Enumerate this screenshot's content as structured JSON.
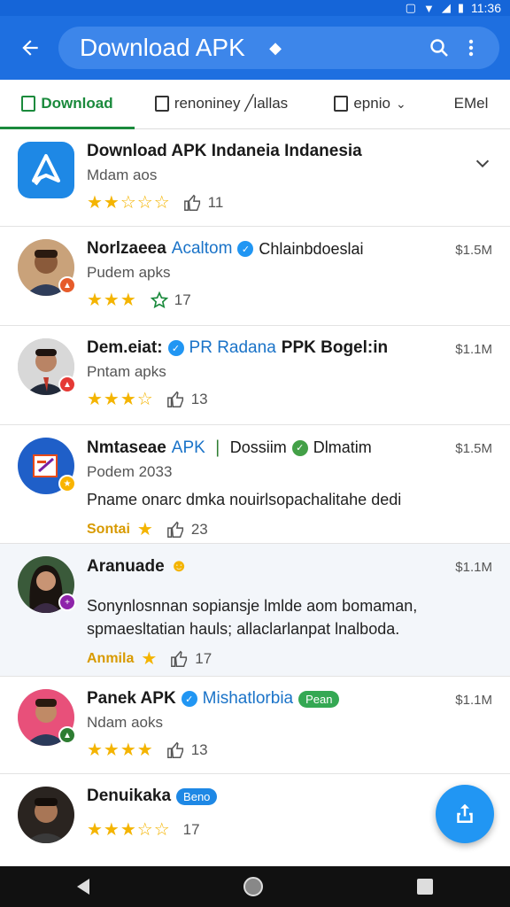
{
  "status": {
    "time": "11:36"
  },
  "app_bar": {
    "title": "Download APK",
    "icons": [
      "back-arrow-icon",
      "search-icon",
      "more-vert-icon"
    ]
  },
  "tabs": [
    {
      "label": "Download",
      "active": true
    },
    {
      "label": "renoniney ╱lallas",
      "active": false
    },
    {
      "label": "epnio",
      "active": false
    },
    {
      "label": "EMel",
      "active": false
    }
  ],
  "rows": [
    {
      "title": "Download APK Indaneia Indanesia",
      "sub": "Mdam aos",
      "stars": "★★☆☆☆",
      "likes": "11"
    },
    {
      "title": "Norlzaeea",
      "tag": "Acaltom",
      "extra": "Chlainbdoeslai",
      "sub": "Pudem apks",
      "stars": "★★★",
      "likes": "17",
      "size": "$1.5M"
    },
    {
      "title": "Dem.eiat:",
      "tag": "PR Radana",
      "extra": "PPK Bogel:in",
      "sub": "Pntam apks",
      "stars": "★★★☆",
      "likes": "13",
      "size": "$1.1M"
    },
    {
      "title": "Nmtaseae",
      "tag": "APK",
      "extra": "Dossiim",
      "extra2": "Dlmatim",
      "sub": "Podem 2033",
      "body": "Pname onarc dmka nouirlsopachalitahe dedi",
      "rank": "Sontai",
      "likes": "23",
      "size": "$1.5M"
    },
    {
      "title": "Aranuade",
      "body": "Sonynlosnnan sopiansje lmlde aom bomaman, spmaesltatian hauls; allaclarlanpat lnalboda.",
      "rank": "Anmila",
      "likes": "17",
      "size": "$1.1M"
    },
    {
      "title": "Panek APK",
      "tag": "Mishatlorbia",
      "badge": "Pean",
      "sub": "Ndam aoks",
      "stars": "★★★★",
      "likes": "13",
      "size": "$1.1M"
    },
    {
      "title": "Denuikaka",
      "badge": "Beno",
      "stars": "★★★☆☆",
      "likes": "17"
    }
  ],
  "colors": {
    "primary": "#1e6fe0",
    "accent_green": "#1a8a3c",
    "star": "#f4b400",
    "fab": "#2196f3"
  }
}
